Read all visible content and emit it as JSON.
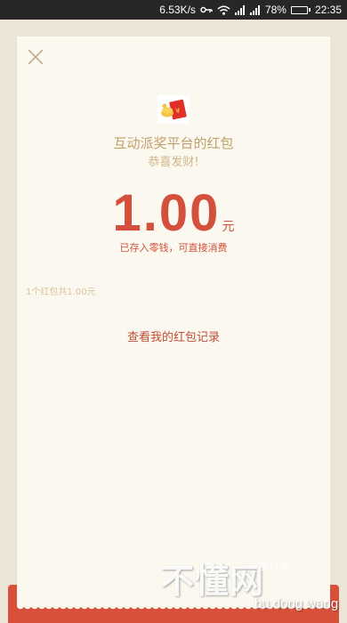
{
  "status_bar": {
    "network_speed": "6.53K/s",
    "battery_percent": "78%",
    "battery_level": 0.78,
    "time": "22:35"
  },
  "card": {
    "sender_title": "互动派奖平台的红包",
    "greeting": "恭喜发财!",
    "amount": "1.00",
    "unit": "元",
    "stored_note": "已存入零钱，可直接消费",
    "packet_summary": "1个红包共1.00元",
    "records_link": "查看我的红包记录"
  },
  "watermark": {
    "main": "不懂网",
    "small": "爱分享",
    "sub": "bu dong wang"
  },
  "colors": {
    "accent_red": "#d3503c",
    "gold": "#c19f6a",
    "card_bg": "#fbf8ef",
    "page_bg": "#ece4d4"
  }
}
